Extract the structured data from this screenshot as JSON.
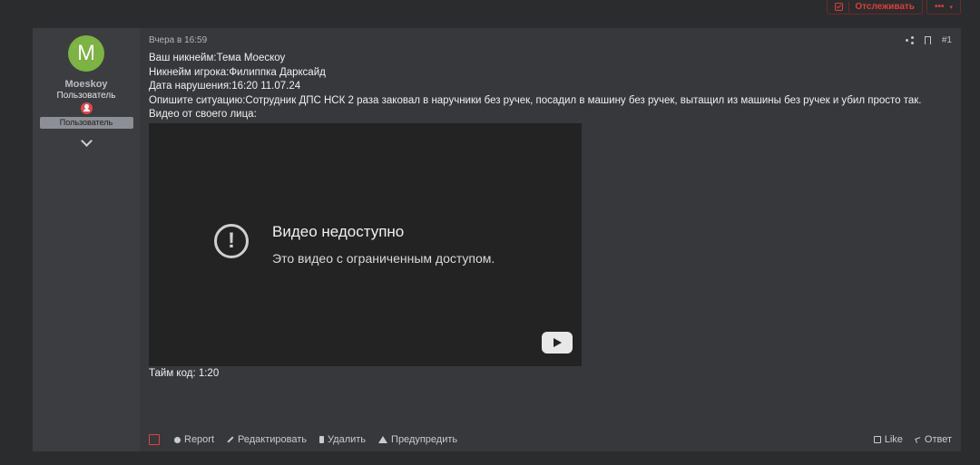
{
  "top_actions": {
    "watch_label": "Отслеживать",
    "more_label": "•••"
  },
  "user": {
    "avatar_letter": "M",
    "name": "Moeskoy",
    "title": "Пользователь",
    "banner": "Пользователь"
  },
  "post": {
    "timestamp": "Вчера в 16:59",
    "number": "#1",
    "lines": [
      "Ваш никнейм:Тема Моескоу",
      "Никнейм игрока:Филиппка Даркcайд",
      "Дата нарушения:16:20 11.07.24",
      "Опишите ситуацию:Сотрудник ДПС НСК 2 раза заковал в наручники без ручек, посадил в машину без ручек, вытащил из машины без ручек и убил просто так.",
      "Видео от своего лица:"
    ],
    "video": {
      "title": "Видео недоступно",
      "subtitle": "Это видео с ограниченным доступом."
    },
    "timecode": "Тайм код: 1:20"
  },
  "footer": {
    "report": "Report",
    "edit": "Редактировать",
    "delete": "Удалить",
    "warn": "Предупредить",
    "like": "Like",
    "reply": "Ответ"
  },
  "colors": {
    "accent_red": "#e03b3b",
    "avatar_green": "#7cb342"
  }
}
